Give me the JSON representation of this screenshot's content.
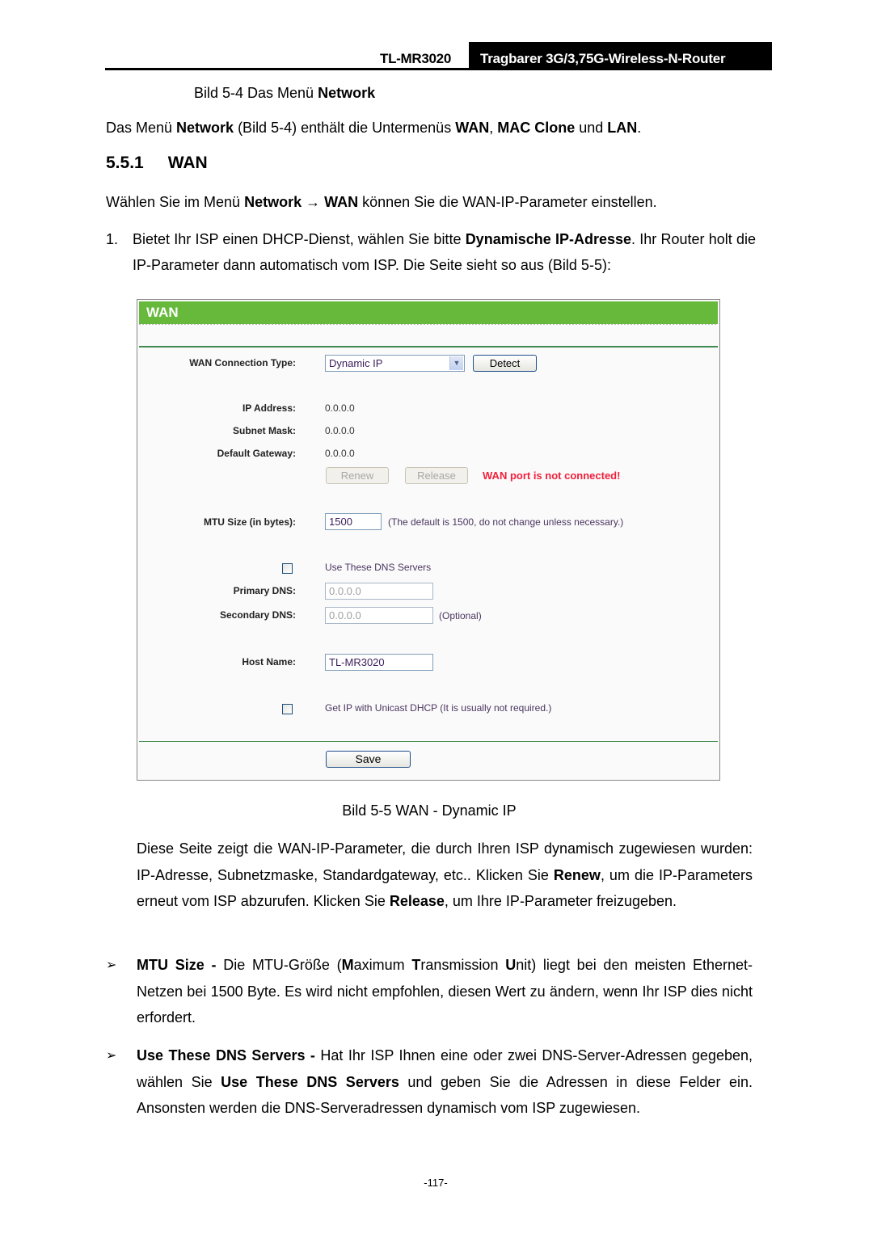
{
  "header": {
    "model": "TL-MR3020",
    "title": "Tragbarer 3G/3,75G-Wireless-N-Router"
  },
  "fig_4_caption": {
    "prefix": "Bild 5-4 Das Menü ",
    "bold": "Network"
  },
  "intro": {
    "p1": "Das Menü ",
    "b1": "Network",
    "p2": " (Bild 5-4) enthält die Untermenüs ",
    "b2": "WAN",
    "p3": ", ",
    "b3": "MAC Clone",
    "p4": " und ",
    "b4": "LAN",
    "p5": "."
  },
  "section": {
    "number": "5.5.1",
    "title": "WAN"
  },
  "select_line": {
    "p1": "Wählen Sie im Menü ",
    "b1": "Network",
    "arrow": " → ",
    "b2": "WAN",
    "p2": " können Sie die WAN-IP-Parameter einstellen."
  },
  "step1": {
    "num": "1.",
    "p1": "Bietet Ihr ISP einen DHCP-Dienst, wählen Sie bitte ",
    "b1": "Dynamische IP-Adresse",
    "p2": ". Ihr Router holt die IP-Parameter dann automatisch vom ISP. Die Seite sieht so aus (Bild 5-5):"
  },
  "wan_panel": {
    "title": "WAN",
    "connection_type_label": "WAN Connection Type:",
    "connection_type_value": "Dynamic IP",
    "detect_label": "Detect",
    "ip_label": "IP Address:",
    "ip_value": "0.0.0.0",
    "mask_label": "Subnet Mask:",
    "mask_value": "0.0.0.0",
    "gateway_label": "Default Gateway:",
    "gateway_value": "0.0.0.0",
    "renew_label": "Renew",
    "release_label": "Release",
    "status_error": "WAN port is not connected!",
    "mtu_label": "MTU Size (in bytes):",
    "mtu_value": "1500",
    "mtu_hint": "(The default is 1500, do not change unless necessary.)",
    "use_dns_label": "Use These DNS Servers",
    "use_dns_checked": false,
    "primary_dns_label": "Primary DNS:",
    "primary_dns_value": "0.0.0.0",
    "secondary_dns_label": "Secondary DNS:",
    "secondary_dns_value": "0.0.0.0",
    "optional_hint": "(Optional)",
    "host_name_label": "Host Name:",
    "host_name_value": "TL-MR3020",
    "unicast_label": "Get IP with Unicast DHCP (It is usually not required.)",
    "unicast_checked": false,
    "save_label": "Save",
    "colors": {
      "header_green": "#66b93a",
      "error_red": "#f0203c",
      "divider_green": "#3e8a4f"
    }
  },
  "fig_5_caption": "Bild 5-5 WAN - Dynamic IP",
  "desc": {
    "p1": "Diese Seite zeigt die WAN-IP-Parameter, die durch Ihren ISP dynamisch zugewiesen wurden: IP-Adresse, Subnetzmaske, Standardgateway, etc.. Klicken Sie ",
    "b1": "Renew",
    "p2": ", um die IP-Parameters erneut vom ISP abzurufen. Klicken Sie ",
    "b2": "Release",
    "p3": ", um Ihre IP-Parameter freizugeben."
  },
  "bullets": [
    {
      "glyph": "➢",
      "b1": "MTU Size - ",
      "p1": "Die MTU-Größe (",
      "m": "M",
      "p2": "aximum ",
      "t": "T",
      "p3": "ransmission ",
      "u": "U",
      "p4": "nit) liegt bei den meisten Ethernet-Netzen bei 1500 Byte. Es wird nicht empfohlen, diesen Wert zu ändern, wenn Ihr ISP dies nicht erfordert."
    },
    {
      "glyph": "➢",
      "b1": "Use These DNS Servers - ",
      "p1": "Hat Ihr ISP Ihnen eine oder zwei DNS-Server-Adressen gegeben, wählen Sie ",
      "b2": "Use These DNS Servers",
      "p2": " und geben Sie die Adressen in diese Felder ein. Ansonsten werden die DNS-Serveradressen dynamisch vom ISP zugewiesen."
    }
  ],
  "page_number": "-117-"
}
